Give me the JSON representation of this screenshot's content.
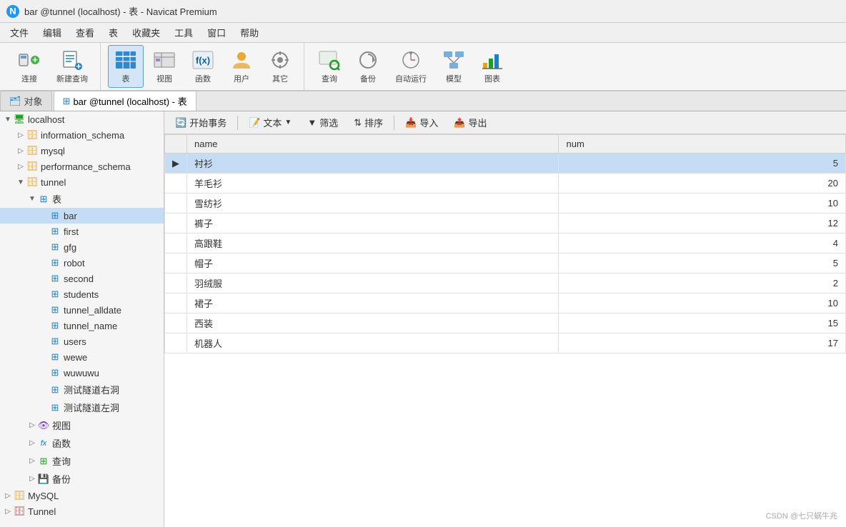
{
  "window": {
    "title": "bar @tunnel (localhost) - 表 - Navicat Premium"
  },
  "menu": {
    "items": [
      "文件",
      "编辑",
      "查看",
      "表",
      "收藏夹",
      "工具",
      "窗口",
      "帮助"
    ]
  },
  "toolbar": {
    "groups": [
      {
        "buttons": [
          {
            "id": "connect",
            "label": "连接",
            "icon": "🔗"
          },
          {
            "id": "new-query",
            "label": "新建查询",
            "icon": "📋"
          }
        ]
      },
      {
        "buttons": [
          {
            "id": "table",
            "label": "表",
            "icon": "⊞",
            "active": true
          },
          {
            "id": "view",
            "label": "视图",
            "icon": "👁"
          },
          {
            "id": "function",
            "label": "函数",
            "icon": "fx"
          },
          {
            "id": "user",
            "label": "用户",
            "icon": "👤"
          },
          {
            "id": "other",
            "label": "其它",
            "icon": "⚙"
          }
        ]
      },
      {
        "buttons": [
          {
            "id": "query",
            "label": "查询",
            "icon": "🔍"
          },
          {
            "id": "backup",
            "label": "备份",
            "icon": "↺"
          },
          {
            "id": "autorun",
            "label": "自动运行",
            "icon": "⏱"
          },
          {
            "id": "model",
            "label": "模型",
            "icon": "📊"
          },
          {
            "id": "chart",
            "label": "图表",
            "icon": "📈"
          }
        ]
      }
    ]
  },
  "tabs": {
    "object_tab": "对象",
    "bar_tab": "bar @tunnel (localhost) - 表"
  },
  "action_bar": {
    "begin_transaction": "开始事务",
    "text": "文本",
    "filter": "筛选",
    "sort": "排序",
    "import": "导入",
    "export": "导出"
  },
  "table": {
    "columns": [
      "",
      "name",
      "num"
    ],
    "rows": [
      {
        "indicator": "▶",
        "name": "衬衫",
        "num": "5",
        "selected": true
      },
      {
        "indicator": "",
        "name": "羊毛衫",
        "num": "20",
        "selected": false
      },
      {
        "indicator": "",
        "name": "雪纺衫",
        "num": "10",
        "selected": false
      },
      {
        "indicator": "",
        "name": "裤子",
        "num": "12",
        "selected": false
      },
      {
        "indicator": "",
        "name": "高跟鞋",
        "num": "4",
        "selected": false
      },
      {
        "indicator": "",
        "name": "帽子",
        "num": "5",
        "selected": false
      },
      {
        "indicator": "",
        "name": "羽绒服",
        "num": "2",
        "selected": false
      },
      {
        "indicator": "",
        "name": "裙子",
        "num": "10",
        "selected": false
      },
      {
        "indicator": "",
        "name": "西装",
        "num": "15",
        "selected": false
      },
      {
        "indicator": "",
        "name": "机器人",
        "num": "17",
        "selected": false
      }
    ]
  },
  "sidebar": {
    "localhost": {
      "label": "localhost",
      "databases": [
        {
          "name": "information_schema",
          "icon": "db"
        },
        {
          "name": "mysql",
          "icon": "db"
        },
        {
          "name": "performance_schema",
          "icon": "db"
        },
        {
          "name": "tunnel",
          "icon": "db",
          "expanded": true,
          "children": {
            "tables": {
              "label": "表",
              "expanded": true,
              "items": [
                "bar",
                "first",
                "gfg",
                "robot",
                "second",
                "students",
                "tunnel_alldate",
                "tunnel_name",
                "users",
                "wewe",
                "wuwuwu",
                "测试隧道右洞",
                "测试隧道左洞"
              ]
            },
            "views": {
              "label": "视图",
              "expanded": false
            },
            "functions": {
              "label": "函数",
              "expanded": false
            },
            "queries": {
              "label": "查询",
              "expanded": false
            },
            "backups": {
              "label": "备份",
              "expanded": false
            }
          }
        }
      ]
    },
    "bottom_items": [
      {
        "label": "MySQL",
        "icon": "mysql"
      },
      {
        "label": "Tunnel",
        "icon": "tunnel"
      }
    ]
  },
  "watermark": "CSDN @七只蜗牛兆"
}
